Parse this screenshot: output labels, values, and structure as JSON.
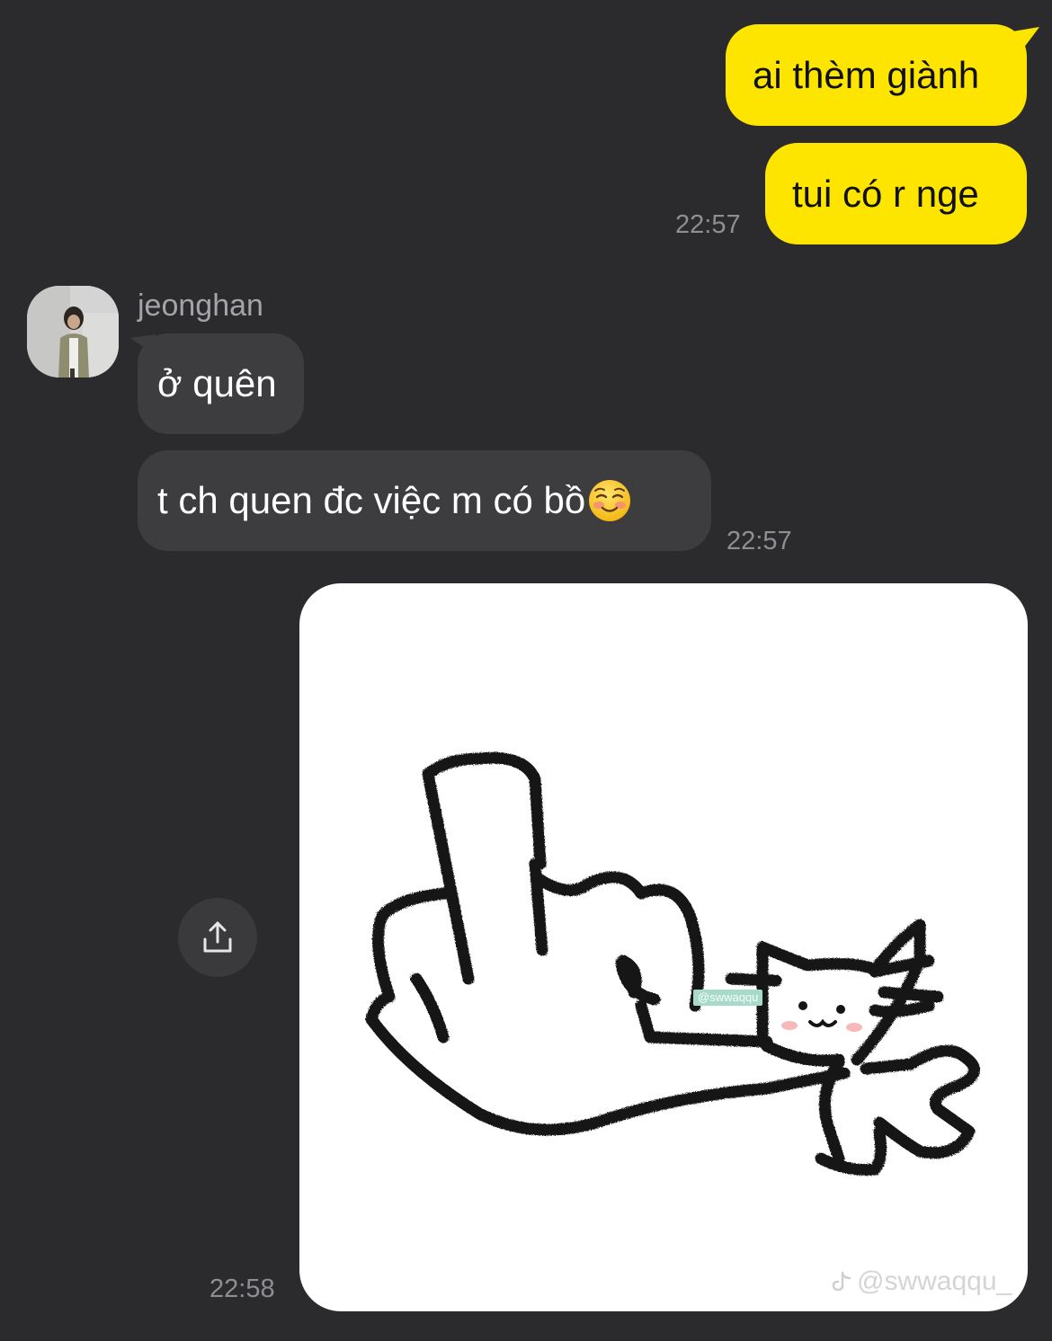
{
  "colors": {
    "background": "#2b2b2d",
    "outgoing_bubble": "#fde500",
    "incoming_bubble": "#3d3d40",
    "timestamp": "#8e8e93"
  },
  "messages": {
    "out_1": "ai thèm giành",
    "out_2": "tui có r nge",
    "out_time": "22:57",
    "sender_name": "jeonghan",
    "in_1": "ở quên",
    "in_2": "t ch quen đc việc m có bồ",
    "in_2_emoji": "smiling-face-icon",
    "in_time": "22:57",
    "image_time": "22:58"
  },
  "image": {
    "tag": "@swwaqqu",
    "watermark": "@swwaqqu_",
    "watermark_icon": "tiktok-icon"
  },
  "share": {
    "icon": "share-icon"
  }
}
